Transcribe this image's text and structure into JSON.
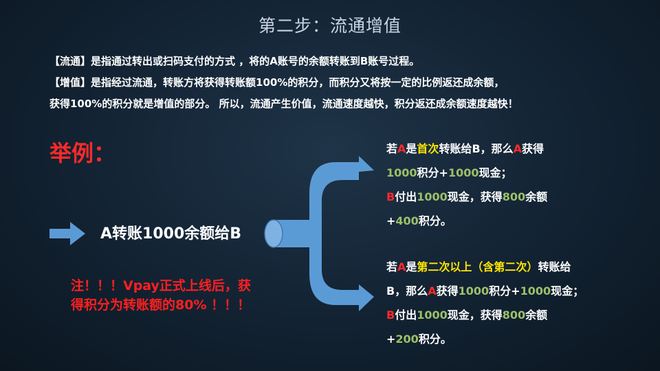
{
  "title": "第二步：流通增值",
  "intro": {
    "line1": "【流通】是指通过转出或扫码支付的方式 ，将的A账号的余额转账到B账号过程。",
    "line2": "【增值】是指经过流通，转账方将获得转账额100%的积分，而积分又将按一定的比例返还成余额，",
    "line3": "获得100%的积分就是增值的部分。 所以，流通产生价值，流通速度越快，积分返还成余额速度越快！"
  },
  "example_label": "举例：",
  "source_text": "A转账1000余额给B",
  "warning": "注！！！Vpay正式上线后，获得积分为转账额的80% ！！！",
  "case1": {
    "l1a": "若",
    "l1b": "A",
    "l1c": "是",
    "l1d": "首次",
    "l1e": "转账给B，那么",
    "l1f": "A",
    "l1g": "获得",
    "l2a": "1000",
    "l2b": "积分+",
    "l2c": "1000",
    "l2d": "现金；",
    "l3a": "B",
    "l3b": "付出",
    "l3c": "1000",
    "l3d": "现金，获得",
    "l3e": "800",
    "l3f": "余额",
    "l4a": "+",
    "l4b": "400",
    "l4c": "积分。"
  },
  "case2": {
    "l1a": "若",
    "l1b": "A",
    "l1c": "是",
    "l1d": "第二次以上（含第二次）",
    "l1e": "转账给",
    "l2a": "B，那么",
    "l2b": "A",
    "l2c": "获得",
    "l2d": "1000",
    "l2e": "积分+",
    "l2f": "1000",
    "l2g": "现金；",
    "l3a": "B",
    "l3b": "付出",
    "l3c": "1000",
    "l3d": "现金，获得",
    "l3e": "800",
    "l3f": "余额",
    "l4a": "+",
    "l4b": "200",
    "l4c": "积分。"
  },
  "colors": {
    "accent_red": "#ff2a2a",
    "accent_yellow": "#ffe600",
    "accent_green": "#9cc069",
    "arrow_blue": "#5b9bd5"
  }
}
